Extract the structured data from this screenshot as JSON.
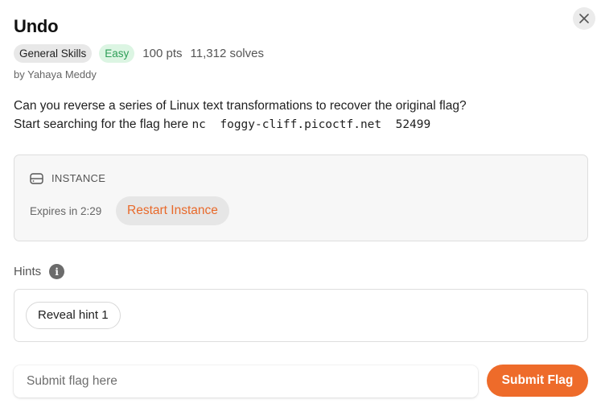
{
  "challenge": {
    "title": "Undo",
    "category": "General Skills",
    "difficulty": "Easy",
    "points": "100 pts",
    "solves": "11,312 solves",
    "author": "by Yahaya Meddy"
  },
  "description": {
    "line1": "Can you reverse a series of Linux text transformations to recover the original flag?",
    "line2_prefix": "Start searching for the flag here ",
    "command": "nc  foggy-cliff.picoctf.net  52499"
  },
  "instance": {
    "label": "INSTANCE",
    "expires": "Expires in 2:29",
    "restart_label": "Restart Instance"
  },
  "hints": {
    "label": "Hints",
    "info_glyph": "i",
    "reveal_label": "Reveal hint 1"
  },
  "flag": {
    "placeholder": "Submit flag here",
    "value": "",
    "submit_label": "Submit Flag"
  },
  "colors": {
    "accent": "#ee6b2a",
    "easy_text": "#2e9e58",
    "easy_bg": "#dcf5e3"
  },
  "icons": {
    "close": "close-icon",
    "instance": "server-icon",
    "info": "info-icon"
  }
}
